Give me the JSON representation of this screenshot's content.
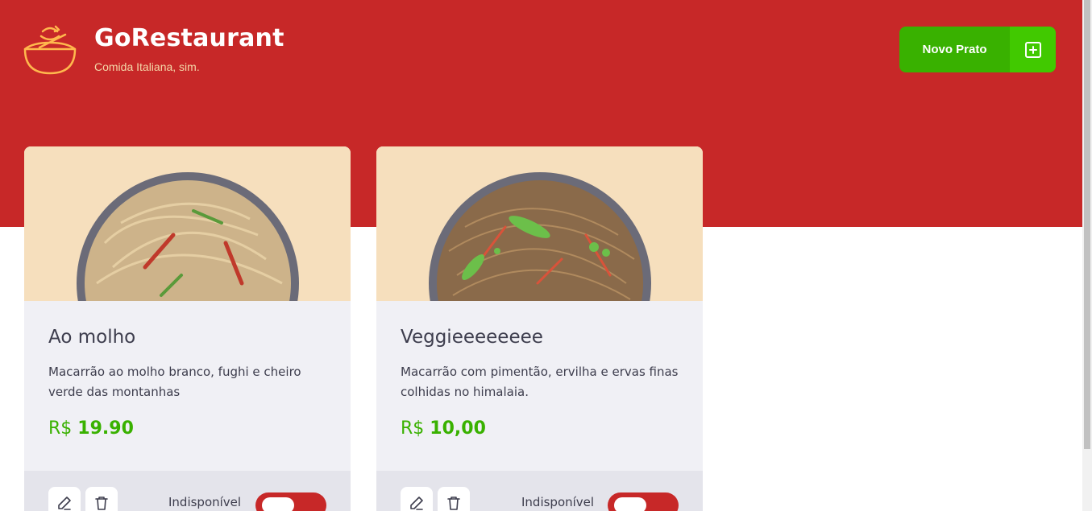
{
  "header": {
    "title": "GoRestaurant",
    "subtitle": "Comida Italiana, sim.",
    "new_button_label": "Novo Prato",
    "logo_icon": "bowl-icon",
    "plus_icon": "plus-square-icon",
    "accent_color": "#c72828",
    "button_color": "#39b100"
  },
  "foods": [
    {
      "name": "Ao molho",
      "description": "Macarrão ao molho branco, fughi e cheiro verde das montanhas",
      "currency": "R$",
      "price": "19.90",
      "availability_label": "Indisponível",
      "available": false
    },
    {
      "name": "Veggieeeeeeee",
      "description": "Macarrão com pimentão, ervilha e ervas finas colhidas no himalaia.",
      "currency": "R$",
      "price": "10,00",
      "availability_label": "Indisponível",
      "available": false
    }
  ]
}
